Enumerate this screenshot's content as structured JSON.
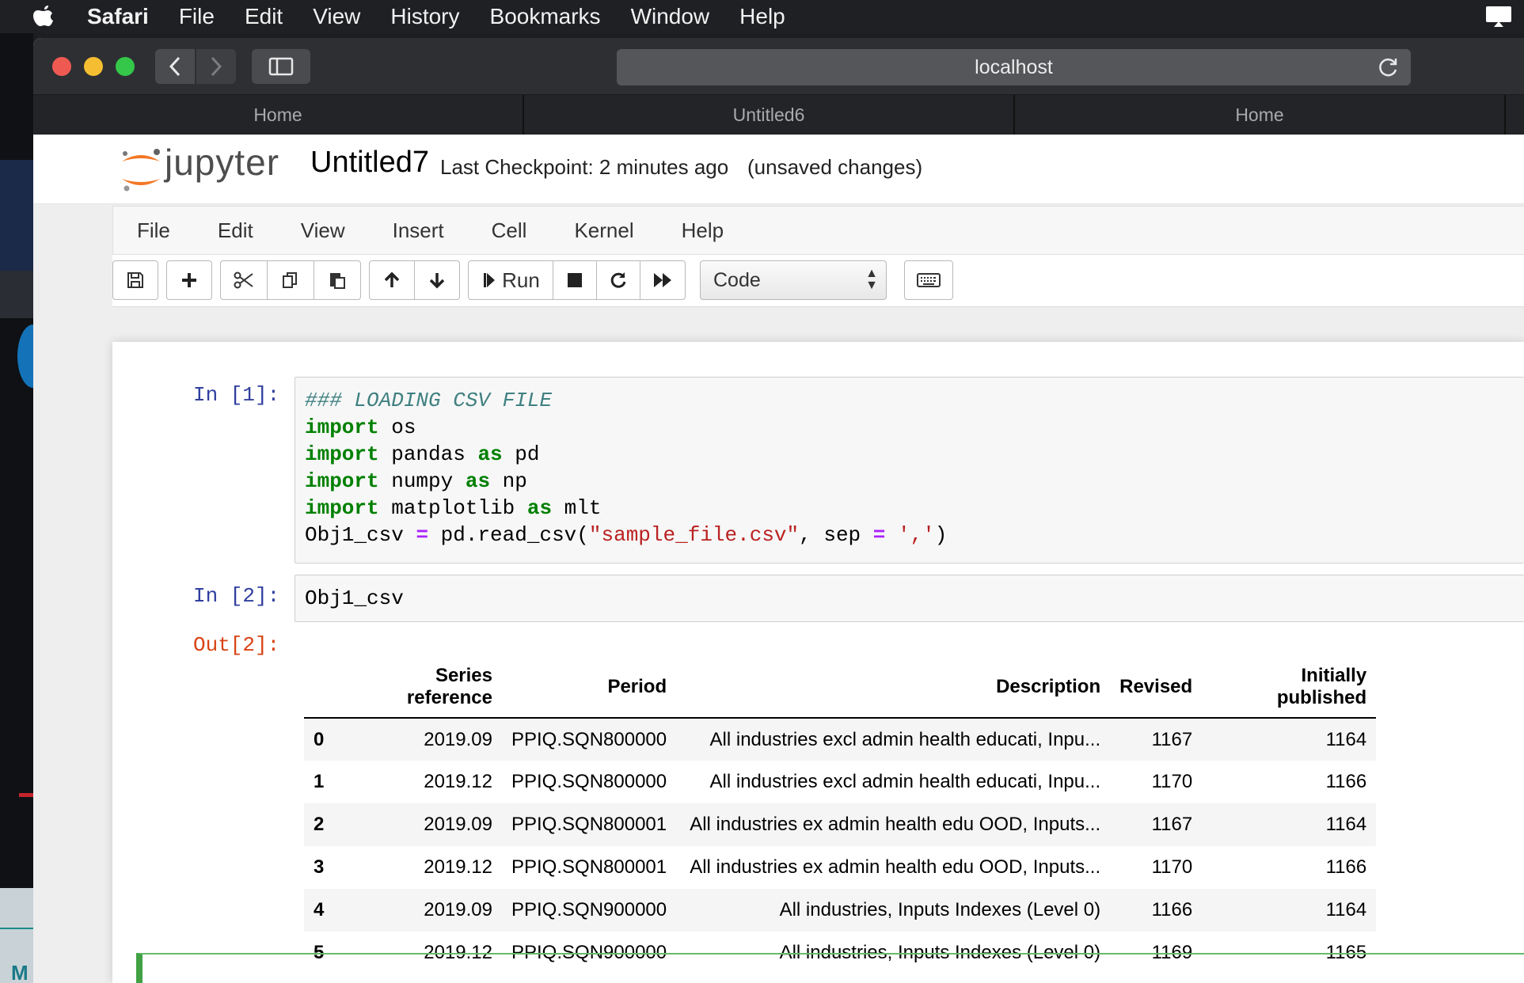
{
  "menubar": {
    "app": "Safari",
    "items": [
      "File",
      "Edit",
      "View",
      "History",
      "Bookmarks",
      "Window",
      "Help"
    ]
  },
  "browser": {
    "url": "localhost",
    "tabs": [
      "Home",
      "Untitled6",
      "Home"
    ]
  },
  "jupyter": {
    "logo_text": "jupyter",
    "notebook_title": "Untitled7",
    "checkpoint": "Last Checkpoint: 2 minutes ago",
    "status": "(unsaved changes)",
    "menu": [
      "File",
      "Edit",
      "View",
      "Insert",
      "Cell",
      "Kernel",
      "Help"
    ],
    "toolbar": {
      "run_label": "Run",
      "cell_type": "Code",
      "icons": [
        "save-icon",
        "plus-icon",
        "cut-icon",
        "copy-icon",
        "paste-icon",
        "arrow-up-icon",
        "arrow-down-icon",
        "run-icon",
        "stop-icon",
        "restart-icon",
        "fast-forward-icon",
        "keyboard-icon"
      ]
    }
  },
  "cells": [
    {
      "prompt": "In [1]:",
      "lines": [
        "### LOADING CSV FILE",
        "import os",
        "import pandas as pd",
        "import numpy as np",
        "import matplotlib as mlt",
        "Obj1_csv = pd.read_csv(\"sample_file.csv\", sep = ',')"
      ]
    },
    {
      "prompt": "In [2]:",
      "lines": [
        "Obj1_csv"
      ],
      "out_prompt": "Out[2]:"
    }
  ],
  "dataframe": {
    "columns": [
      "",
      "Series reference",
      "Period",
      "Description",
      "Revised",
      "Initially published"
    ],
    "rows": [
      [
        "0",
        "2019.09",
        "PPIQ.SQN800000",
        "All industries excl admin health educati, Inpu...",
        "1167",
        "1164"
      ],
      [
        "1",
        "2019.12",
        "PPIQ.SQN800000",
        "All industries excl admin health educati, Inpu...",
        "1170",
        "1166"
      ],
      [
        "2",
        "2019.09",
        "PPIQ.SQN800001",
        "All industries ex admin health edu OOD, Inputs...",
        "1167",
        "1164"
      ],
      [
        "3",
        "2019.12",
        "PPIQ.SQN800001",
        "All industries ex admin health edu OOD, Inputs...",
        "1170",
        "1166"
      ],
      [
        "4",
        "2019.09",
        "PPIQ.SQN900000",
        "All industries, Inputs Indexes (Level 0)",
        "1166",
        "1164"
      ],
      [
        "5",
        "2019.12",
        "PPIQ.SQN900000",
        "All industries, Inputs Indexes (Level 0)",
        "1169",
        "1165"
      ]
    ]
  }
}
